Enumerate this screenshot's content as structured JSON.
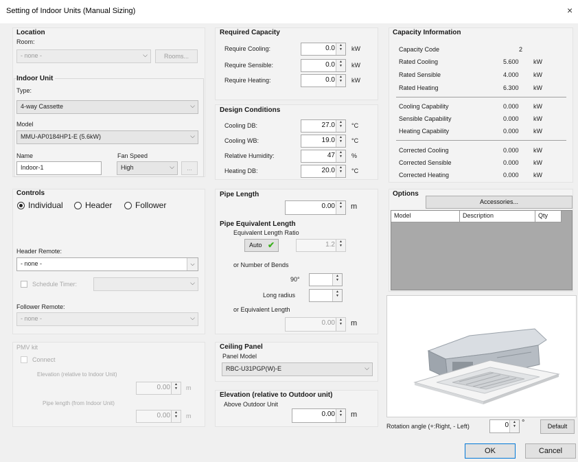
{
  "window": {
    "title": "Setting of Indoor Units (Manual Sizing)",
    "close_label": "×"
  },
  "location": {
    "title": "Location",
    "room_label": "Room:",
    "room_value": "- none -",
    "rooms_button": "Rooms..."
  },
  "indoor_unit": {
    "title": "Indoor Unit",
    "type_label": "Type:",
    "type_value": "4-way Cassette",
    "model_label": "Model",
    "model_value": "MMU-AP0184HP1-E (5.6kW)",
    "name_label": "Name",
    "name_value": "Indoor-1",
    "fan_speed_label": "Fan Speed",
    "fan_speed_value": "High",
    "ellipsis": "..."
  },
  "controls": {
    "title": "Controls",
    "radio_individual": "Individual",
    "radio_header": "Header",
    "radio_follower": "Follower",
    "header_remote_label": "Header Remote:",
    "header_remote_value": "- none -",
    "schedule_timer_label": "Schedule Timer:",
    "follower_remote_label": "Follower Remote:",
    "follower_remote_value": "- none -"
  },
  "pmv": {
    "title": "PMV kit",
    "connect": "Connect",
    "elevation_label": "Elevation  (relative to Indoor Unit)",
    "elevation_value": "0.00",
    "elevation_unit": "m",
    "pipe_length_label": "Pipe length  (from Indoor Unit)",
    "pipe_length_value": "0.00",
    "pipe_length_unit": "m"
  },
  "required_capacity": {
    "title": "Required Capacity",
    "rows": [
      {
        "label": "Require Cooling:",
        "value": "0.0",
        "unit": "kW"
      },
      {
        "label": "Require Sensible:",
        "value": "0.0",
        "unit": "kW"
      },
      {
        "label": "Require Heating:",
        "value": "0.0",
        "unit": "kW"
      }
    ]
  },
  "design_conditions": {
    "title": "Design Conditions",
    "rows": [
      {
        "label": "Cooling DB:",
        "value": "27.0",
        "unit": "°C"
      },
      {
        "label": "Cooling WB:",
        "value": "19.0",
        "unit": "°C"
      },
      {
        "label": "Relative Humidity:",
        "value": "47",
        "unit": "%"
      },
      {
        "label": "Heating DB:",
        "value": "20.0",
        "unit": "°C"
      }
    ]
  },
  "pipe_length": {
    "title": "Pipe Length",
    "value": "0.00",
    "unit": "m"
  },
  "pipe_equivalent": {
    "title": "Pipe Equivalent Length",
    "ratio_label": "Equivalent Length Ratio",
    "auto_label": "Auto",
    "ratio_value": "1.2",
    "bends_label": "or Number of Bends",
    "deg90_label": "90°",
    "long_radius_label": "Long radius",
    "equiv_label": "or Equivalent Length",
    "equiv_value": "0.00",
    "equiv_unit": "m"
  },
  "ceiling_panel": {
    "title": "Ceiling Panel",
    "model_label": "Panel Model",
    "model_value": "RBC-U31PGP(W)-E"
  },
  "elevation": {
    "title": "Elevation (relative to Outdoor unit)",
    "above_label": "Above Outdoor Unit",
    "value": "0.00",
    "unit": "m"
  },
  "capacity_info": {
    "title": "Capacity Information",
    "code_label": "Capacity Code",
    "code_value": "2",
    "rated": [
      {
        "label": "Rated Cooling",
        "value": "5.600",
        "unit": "kW"
      },
      {
        "label": "Rated Sensible",
        "value": "4.000",
        "unit": "kW"
      },
      {
        "label": "Rated Heating",
        "value": "6.300",
        "unit": "kW"
      }
    ],
    "capability": [
      {
        "label": "Cooling Capability",
        "value": "0.000",
        "unit": "kW"
      },
      {
        "label": "Sensible Capability",
        "value": "0.000",
        "unit": "kW"
      },
      {
        "label": "Heating Capability",
        "value": "0.000",
        "unit": "kW"
      }
    ],
    "corrected": [
      {
        "label": "Corrected Cooling",
        "value": "0.000",
        "unit": "kW"
      },
      {
        "label": "Corrected Sensible",
        "value": "0.000",
        "unit": "kW"
      },
      {
        "label": "Corrected Heating",
        "value": "0.000",
        "unit": "kW"
      }
    ]
  },
  "options": {
    "title": "Options",
    "accessories_button": "Accessories...",
    "columns": [
      "Model",
      "Description",
      "Qty"
    ]
  },
  "rotation": {
    "label": "Rotation angle (+:Right, - Left)",
    "value": "0",
    "unit": "°",
    "default_button": "Default"
  },
  "footer": {
    "ok": "OK",
    "cancel": "Cancel"
  },
  "colors": {
    "dialog_bg": "#f0f0f0",
    "group_bg": "#f3f3f3",
    "grid_bg": "#a9a9a9",
    "check_green": "#3cb01f"
  }
}
